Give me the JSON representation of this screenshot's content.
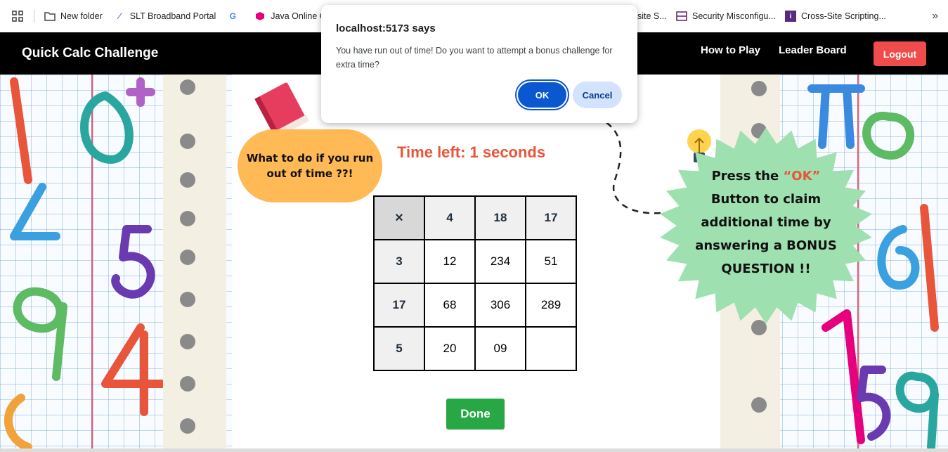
{
  "bookmarks": {
    "items": [
      {
        "label": "New folder",
        "icon": "folder-icon"
      },
      {
        "label": "SLT Broadband Portal",
        "icon": "slt-icon"
      },
      {
        "label": "",
        "icon": "google-icon"
      },
      {
        "label": "Java Online Cour",
        "icon": "java-cube-icon"
      },
      {
        "label": "site S...",
        "icon": ""
      },
      {
        "label": "Security Misconfigu...",
        "icon": "security-icon"
      },
      {
        "label": "Cross-Site Scripting...",
        "icon": "xss-icon"
      }
    ],
    "more": "»"
  },
  "header": {
    "title": "Quick Calc Challenge",
    "how_to_play": "How to Play",
    "leader_board": "Leader Board",
    "logout": "Logout"
  },
  "main": {
    "bubble_text": "What to do if you run out of time ??!",
    "timer": "Time left: 1 seconds",
    "star_text_pre": "Press the ",
    "star_text_highlight": "“OK”",
    "star_text_post": " Button to claim additional time by answering a BONUS QUESTION !!",
    "done": "Done"
  },
  "grid": {
    "corner": "×",
    "col_headers": [
      "4",
      "18",
      "17"
    ],
    "rows": [
      {
        "header": "3",
        "cells": [
          "12",
          "234",
          "51"
        ]
      },
      {
        "header": "17",
        "cells": [
          "68",
          "306",
          "289"
        ]
      },
      {
        "header": "5",
        "cells": [
          "20",
          "09",
          ""
        ]
      }
    ]
  },
  "dialog": {
    "title": "localhost:5173 says",
    "message": "You have run out of time! Do you want to attempt a bonus challenge for extra time?",
    "ok": "OK",
    "cancel": "Cancel"
  },
  "colors": {
    "header_bg": "#000000",
    "logout_bg": "#f04c4c",
    "timer": "#e8553a",
    "done_bg": "#28a745",
    "bubble": "#ffb955",
    "star": "#9fe0b0",
    "dialog_ok": "#0b57d0",
    "dialog_cancel": "#d3e3fd"
  }
}
